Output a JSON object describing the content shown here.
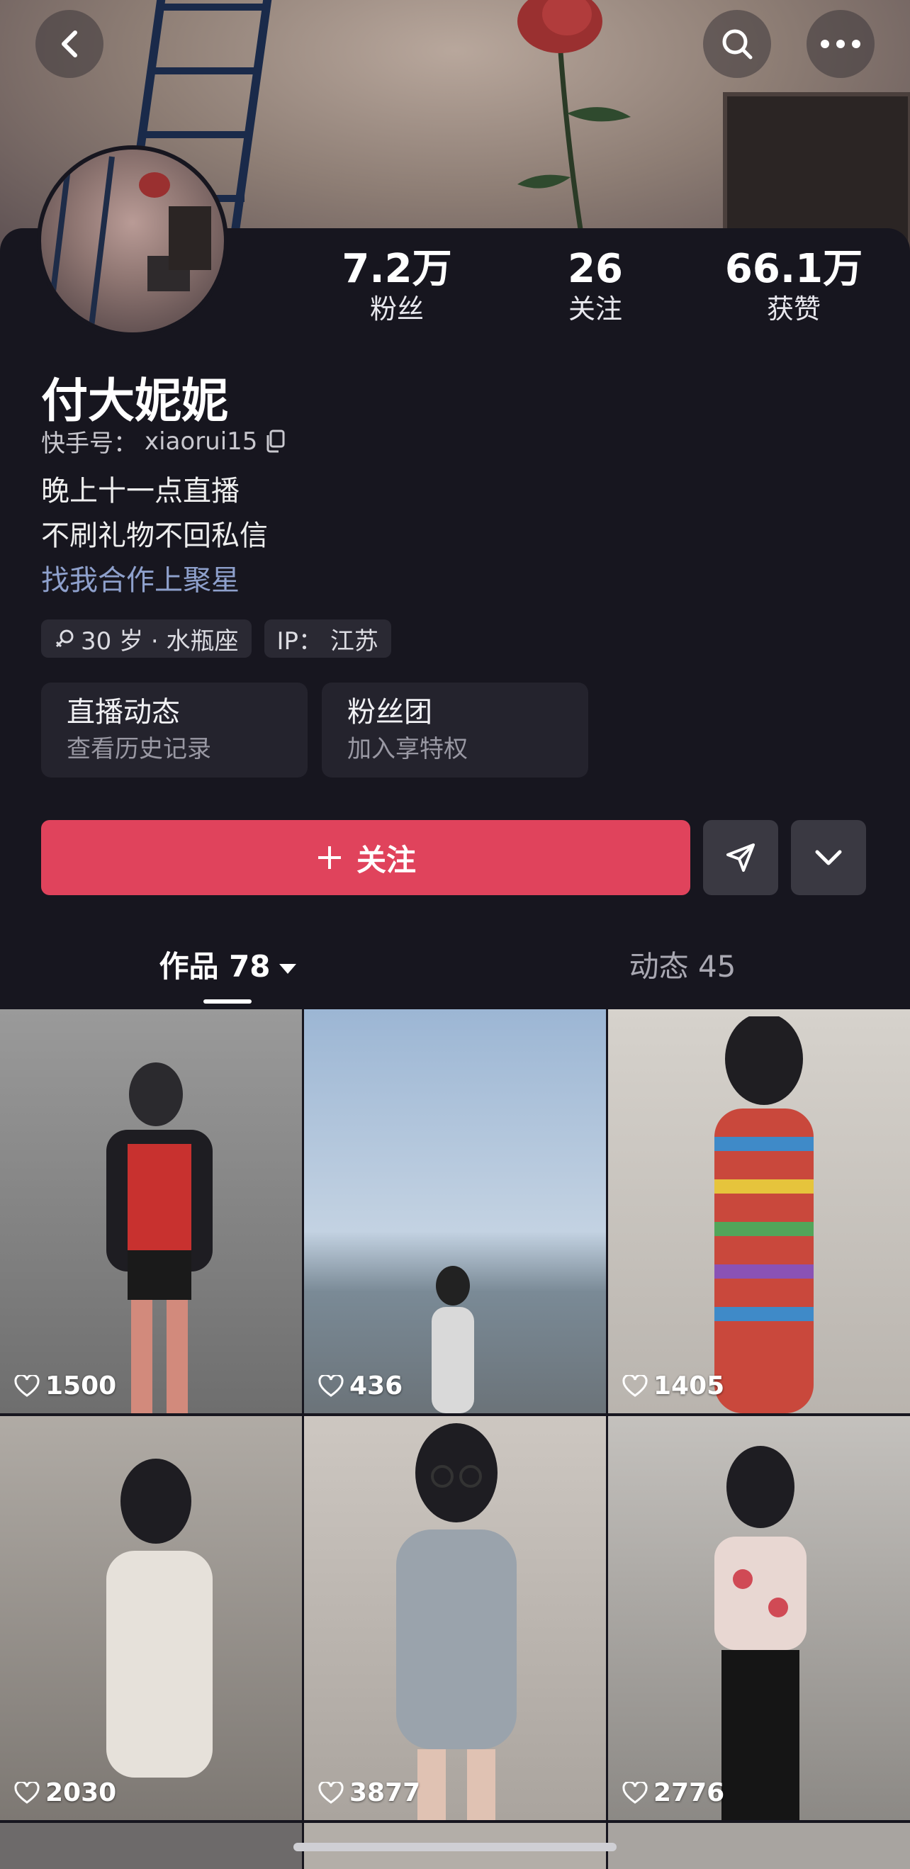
{
  "header": {
    "back_icon": "chevron-left-icon",
    "search_icon": "search-icon",
    "more_icon": "more-horizontal-icon"
  },
  "profile": {
    "name": "付大妮妮",
    "kuaishou_id_label": "快手号：",
    "kuaishou_id": "xiaorui15",
    "bio_lines": [
      "晚上十一点直播",
      "不刷礼物不回私信"
    ],
    "bio_link": "找我合作上聚星",
    "stats": [
      {
        "value": "7.2万",
        "label": "粉丝"
      },
      {
        "value": "26",
        "label": "关注"
      },
      {
        "value": "66.1万",
        "label": "获赞"
      }
    ],
    "tags": [
      {
        "text": "30 岁 · 水瓶座",
        "icon": "female-gender-icon"
      },
      {
        "text": "IP：  江苏"
      }
    ],
    "entries": [
      {
        "title": "直播动态",
        "subtitle": "查看历史记录"
      },
      {
        "title": "粉丝团",
        "subtitle": "加入享特权"
      }
    ]
  },
  "actions": {
    "follow_label": "关注",
    "follow_icon": "plus-icon",
    "share_icon": "send-icon",
    "dropdown_icon": "chevron-down-icon",
    "follow_color": "#e0435c"
  },
  "tabs": [
    {
      "label": "作品 78",
      "active": true
    },
    {
      "label": "动态 45",
      "active": false
    }
  ],
  "posts": [
    {
      "likes": "1500",
      "bg": "#8b8b8b"
    },
    {
      "likes": "436",
      "bg": "#9fb8d6"
    },
    {
      "likes": "1405",
      "bg": "#cfcbc6"
    },
    {
      "likes": "2030",
      "bg": "#a9a49e"
    },
    {
      "likes": "3877",
      "bg": "#c9c3bd"
    },
    {
      "likes": "2776",
      "bg": "#b5b2ae"
    }
  ]
}
